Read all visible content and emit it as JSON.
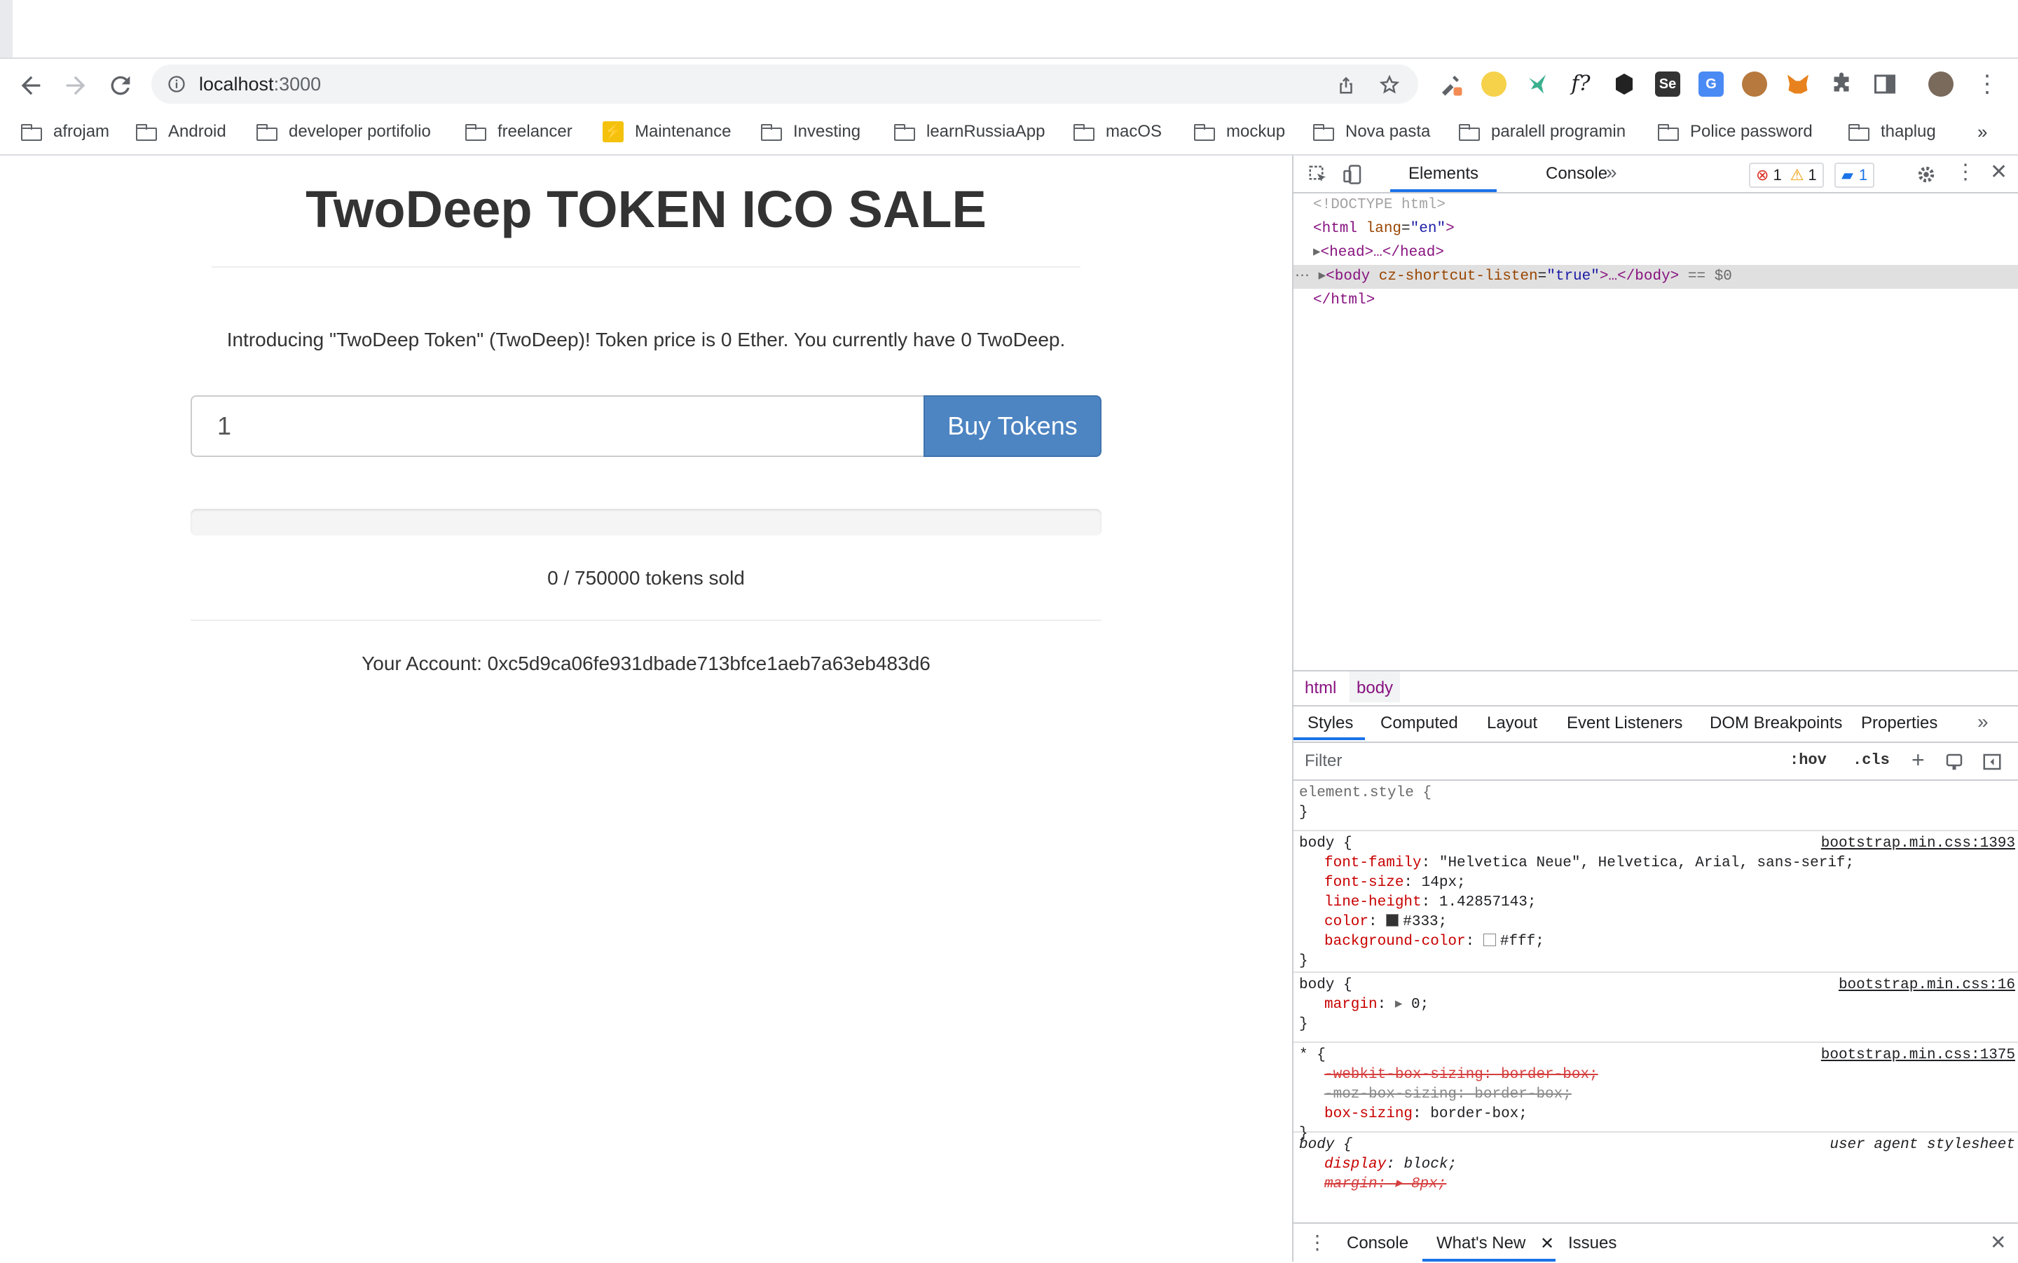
{
  "browser": {
    "url_host": "localhost",
    "url_port": ":3000",
    "bookmarks": [
      "afrojam",
      "Android",
      "developer portifolio",
      "freelancer",
      "Maintenance",
      "Investing",
      "learnRussiaApp",
      "macOS",
      "mockup",
      "Nova pasta",
      "paralell programin",
      "Police password",
      "thaplug"
    ],
    "bookmarks_overflow": "»"
  },
  "page": {
    "title": "TwoDeep TOKEN ICO SALE",
    "intro": "Introducing \"TwoDeep Token\" (TwoDeep)! Token price is 0 Ether. You currently have 0 TwoDeep.",
    "quantity_value": "1",
    "buy_label": "Buy Tokens",
    "progress_fraction": 0,
    "sold_text": "0 / 750000 tokens sold",
    "account_text": "Your Account: 0xc5d9ca06fe931dbade713bfce1aeb7a63eb483d6"
  },
  "devtools": {
    "tabs": [
      "Elements",
      "Console"
    ],
    "errors": "1",
    "warnings": "1",
    "messages": "1",
    "dom": {
      "doctype": "<!DOCTYPE html>",
      "html_open_tag": "<html",
      "html_attr": "lang",
      "html_attr_val": "\"en\"",
      "head": "<head>…</head>",
      "body_tag": "<body",
      "body_attr": "cz-shortcut-listen",
      "body_attr_val": "\"true\"",
      "body_rest": ">…</body>",
      "body_suffix": "== $0",
      "html_close": "</html>"
    },
    "breadcrumb": [
      "html",
      "body"
    ],
    "style_tabs": [
      "Styles",
      "Computed",
      "Layout",
      "Event Listeners",
      "DOM Breakpoints",
      "Properties"
    ],
    "filter_placeholder": "Filter",
    "hov": ":hov",
    "cls": ".cls",
    "rules": {
      "element_style": "element.style {",
      "close": "}",
      "body1_selector": "body {",
      "body1_source": "bootstrap.min.css:1393",
      "font_family_prop": "font-family",
      "font_family_val": "\"Helvetica Neue\", Helvetica, Arial, sans-serif;",
      "font_size_prop": "font-size",
      "font_size_val": "14px;",
      "line_height_prop": "line-height",
      "line_height_val": "1.42857143;",
      "color_prop": "color",
      "color_val": "#333;",
      "bg_prop": "background-color",
      "bg_val": "#fff;",
      "body2_source": "bootstrap.min.css:16",
      "margin_prop": "margin",
      "margin_val": "0;",
      "star_selector": "* {",
      "star_source": "bootstrap.min.css:1375",
      "webkit_line": "-webkit-box-sizing: border-box;",
      "moz_line": "-moz-box-sizing: border-box;",
      "box_prop": "box-sizing",
      "box_val": "border-box;",
      "ua_selector": "body {",
      "ua_source": "user agent stylesheet",
      "display_prop": "display",
      "display_val": "block;",
      "ua_margin_line": "margin: ▸ 8px;"
    },
    "drawer_tabs": [
      "Console",
      "What's New",
      "Issues"
    ]
  },
  "colors": {
    "button": "#4d84c2",
    "accent": "#1a73e8"
  }
}
